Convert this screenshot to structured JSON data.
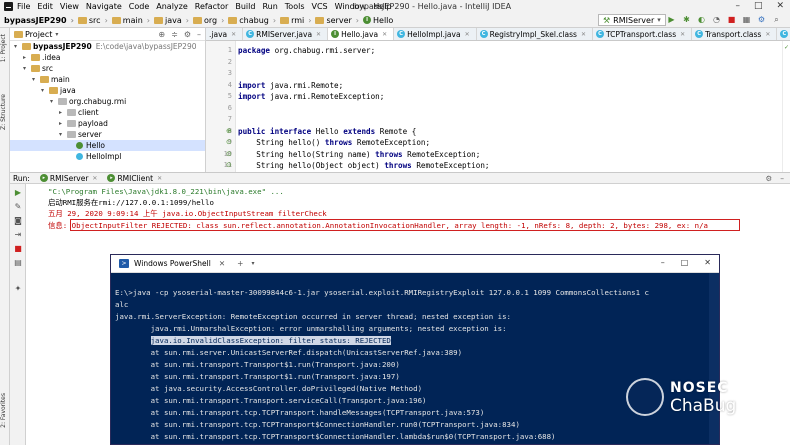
{
  "menubar": {
    "items": [
      "File",
      "Edit",
      "View",
      "Navigate",
      "Code",
      "Analyze",
      "Refactor",
      "Build",
      "Run",
      "Tools",
      "VCS",
      "Window",
      "Help"
    ],
    "title": "bypassJEP290 - Hello.java - IntelliJ IDEA",
    "controls": [
      "–",
      "□",
      "✕"
    ]
  },
  "navbar": {
    "crumbs": [
      "bypassJEP290",
      "src",
      "main",
      "java",
      "org",
      "chabug",
      "rmi",
      "server",
      "Hello"
    ],
    "run_config": "RMIServer"
  },
  "project": {
    "header": "Project",
    "tree": [
      {
        "label": "bypassJEP290",
        "path": "E:\\code\\java\\bypassJEP290",
        "indent": 0,
        "arrow": "▾",
        "icon": "folder"
      },
      {
        "label": ".idea",
        "path": "",
        "indent": 1,
        "arrow": "▸",
        "icon": "folder"
      },
      {
        "label": "src",
        "path": "",
        "indent": 1,
        "arrow": "▾",
        "icon": "folder"
      },
      {
        "label": "main",
        "path": "",
        "indent": 2,
        "arrow": "▾",
        "icon": "folder"
      },
      {
        "label": "java",
        "path": "",
        "indent": 3,
        "arrow": "▾",
        "icon": "folder"
      },
      {
        "label": "org.chabug.rmi",
        "path": "",
        "indent": 4,
        "arrow": "▾",
        "icon": "folder"
      },
      {
        "label": "client",
        "path": "",
        "indent": 5,
        "arrow": "▸",
        "icon": "folder"
      },
      {
        "label": "payload",
        "path": "",
        "indent": 5,
        "arrow": "▸",
        "icon": "folder"
      },
      {
        "label": "server",
        "path": "",
        "indent": 5,
        "arrow": "▾",
        "icon": "folder"
      },
      {
        "label": "Hello",
        "path": "",
        "indent": 6,
        "arrow": "",
        "icon": "interface"
      },
      {
        "label": "HelloImpl",
        "path": "",
        "indent": 6,
        "arrow": "",
        "icon": "class"
      }
    ]
  },
  "sidebar_tabs": [
    "1: Project",
    "Z: Structure",
    "2: Favorites"
  ],
  "editor": {
    "tabs": [
      ".java",
      "RMIServer.java",
      "Hello.java",
      "HelloImpl.java",
      "RegistryImpl_Skel.class",
      "TCPTransport.class",
      "Transport.class",
      "UnicastServerR"
    ],
    "active_tab": 2,
    "lines": [
      {
        "n": "1",
        "text": "package org.chabug.rmi.server;"
      },
      {
        "n": "2",
        "text": ""
      },
      {
        "n": "3",
        "text": ""
      },
      {
        "n": "4",
        "text": "import java.rmi.Remote;"
      },
      {
        "n": "5",
        "text": "import java.rmi.RemoteException;"
      },
      {
        "n": "6",
        "text": ""
      },
      {
        "n": "7",
        "text": ""
      },
      {
        "n": "8",
        "text": "public interface Hello extends Remote {"
      },
      {
        "n": "9",
        "text": "    String hello() throws RemoteException;"
      },
      {
        "n": "10",
        "text": "    String hello(String name) throws RemoteException;"
      },
      {
        "n": "11",
        "text": "    String hello(Object object) throws RemoteException;"
      },
      {
        "n": "12",
        "text": "}"
      }
    ]
  },
  "run": {
    "label": "Run:",
    "tabs": [
      "RMIServer",
      "RMIClient"
    ],
    "console": [
      "\"C:\\Program Files\\Java\\jdk1.8.0_221\\bin\\java.exe\" ...",
      "启动RMI服务在rmi://127.0.0.1:1099/hello",
      "五月 29, 2020 9:09:14 上午 java.io.ObjectInputStream filterCheck",
      "信息: ObjectInputFilter REJECTED: class sun.reflect.annotation.AnnotationInvocationHandler, array length: -1, nRefs: 8, depth: 2, bytes: 298, ex: n/a"
    ]
  },
  "powershell": {
    "title": "Windows PowerShell",
    "lines": [
      "E:\\>java -cp ysoserial-master-30099844c6-1.jar ysoserial.exploit.RMIRegistryExploit 127.0.0.1 1099 CommonsCollections1 c",
      "alc",
      "java.rmi.ServerException: RemoteException occurred in server thread; nested exception is:",
      "        java.rmi.UnmarshalException: error unmarshalling arguments; nested exception is:",
      "        java.io.InvalidClassException: filter status: REJECTED",
      "        at sun.rmi.server.UnicastServerRef.dispatch(UnicastServerRef.java:389)",
      "        at sun.rmi.transport.Transport$1.run(Transport.java:200)",
      "        at sun.rmi.transport.Transport$1.run(Transport.java:197)",
      "        at java.security.AccessController.doPrivileged(Native Method)",
      "        at sun.rmi.transport.Transport.serviceCall(Transport.java:196)",
      "        at sun.rmi.transport.tcp.TCPTransport.handleMessages(TCPTransport.java:573)",
      "        at sun.rmi.transport.tcp.TCPTransport$ConnectionHandler.run0(TCPTransport.java:834)",
      "        at sun.rmi.transport.tcp.TCPTransport$ConnectionHandler.lambda$run$0(TCPTransport.java:688)"
    ],
    "highlight_line": 4
  },
  "watermark": {
    "line1": "NOSEC",
    "line2": "ChaBug"
  }
}
